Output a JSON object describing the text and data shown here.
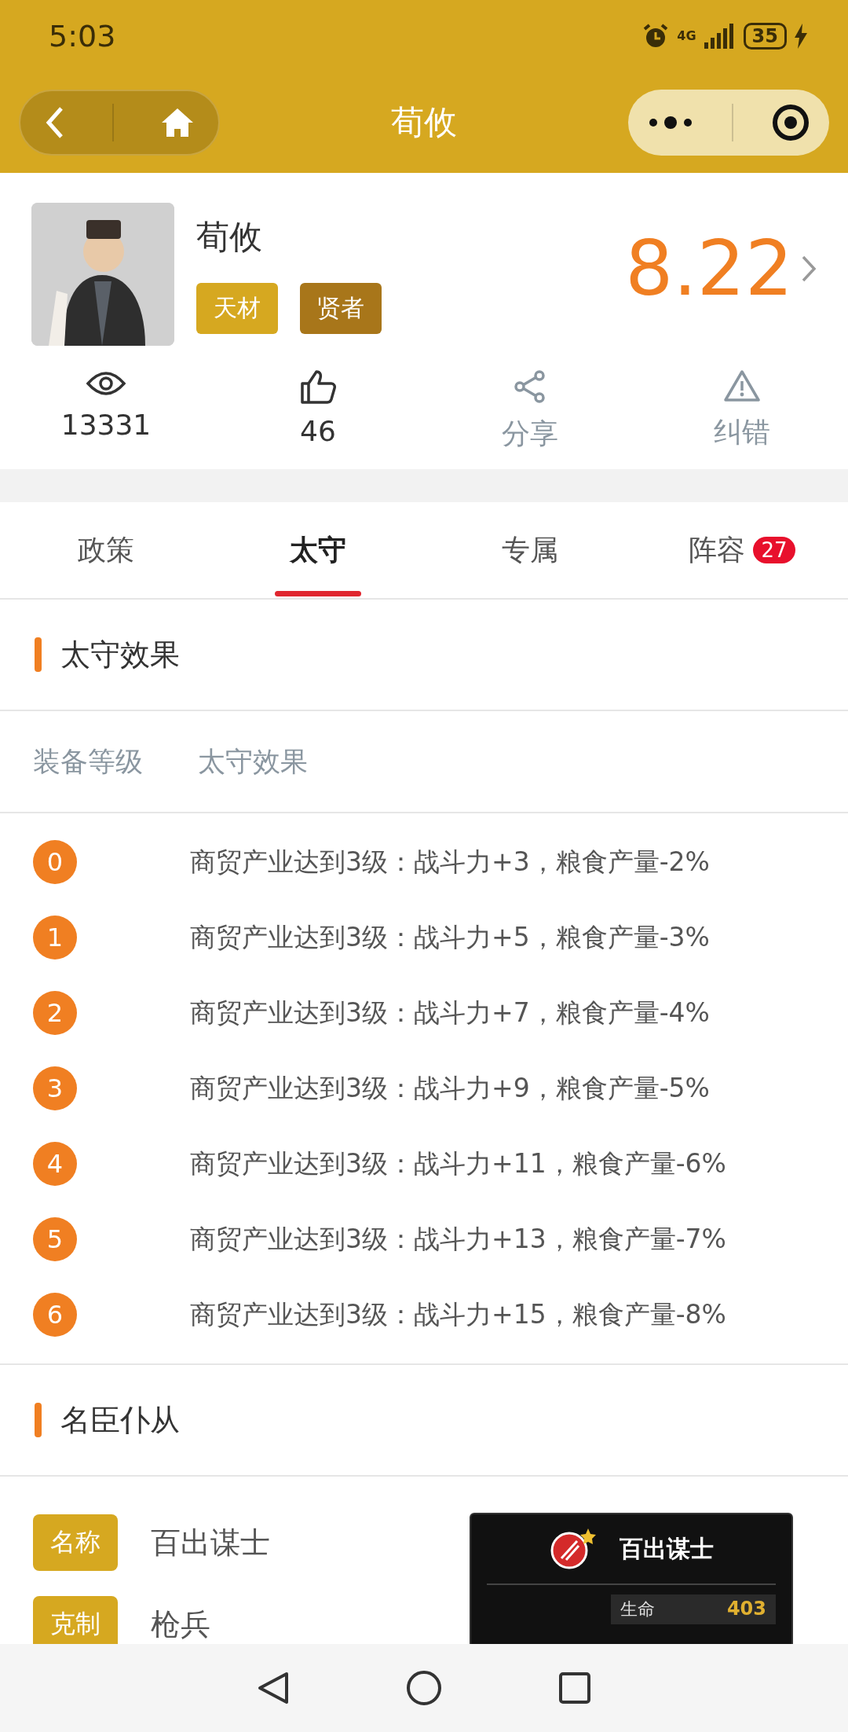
{
  "status_bar": {
    "time": "5:03",
    "network": "4G",
    "battery": "35"
  },
  "nav": {
    "title": "荀攸"
  },
  "profile": {
    "name": "荀攸",
    "tags": [
      {
        "label": "天材",
        "kind": "light"
      },
      {
        "label": "贤者",
        "kind": "dark"
      }
    ],
    "score": "8.22"
  },
  "stats": [
    {
      "kind": "views",
      "label": "13331"
    },
    {
      "kind": "likes",
      "label": "46"
    },
    {
      "kind": "share",
      "label": "分享"
    },
    {
      "kind": "report",
      "label": "纠错"
    }
  ],
  "tabs": [
    {
      "label": "政策",
      "selected": false
    },
    {
      "label": "太守",
      "selected": true
    },
    {
      "label": "专属",
      "selected": false
    },
    {
      "label": "阵容",
      "selected": false,
      "badge": "27"
    }
  ],
  "section_1": {
    "title": "太守效果",
    "columns": [
      "装备等级",
      "太守效果"
    ],
    "rows": [
      {
        "level": "0",
        "effect": "商贸产业达到3级：战斗力+3，粮食产量-2%"
      },
      {
        "level": "1",
        "effect": "商贸产业达到3级：战斗力+5，粮食产量-3%"
      },
      {
        "level": "2",
        "effect": "商贸产业达到3级：战斗力+7，粮食产量-4%"
      },
      {
        "level": "3",
        "effect": "商贸产业达到3级：战斗力+9，粮食产量-5%"
      },
      {
        "level": "4",
        "effect": "商贸产业达到3级：战斗力+11，粮食产量-6%"
      },
      {
        "level": "5",
        "effect": "商贸产业达到3级：战斗力+13，粮食产量-7%"
      },
      {
        "level": "6",
        "effect": "商贸产业达到3级：战斗力+15，粮食产量-8%"
      }
    ]
  },
  "section_2": {
    "title": "名臣仆从",
    "fields": [
      {
        "label": "名称",
        "value": "百出谋士"
      },
      {
        "label": "克制",
        "value": "枪兵"
      }
    ],
    "card": {
      "title": "百出谋士",
      "stat_label": "生命",
      "stat_value": "403"
    }
  }
}
